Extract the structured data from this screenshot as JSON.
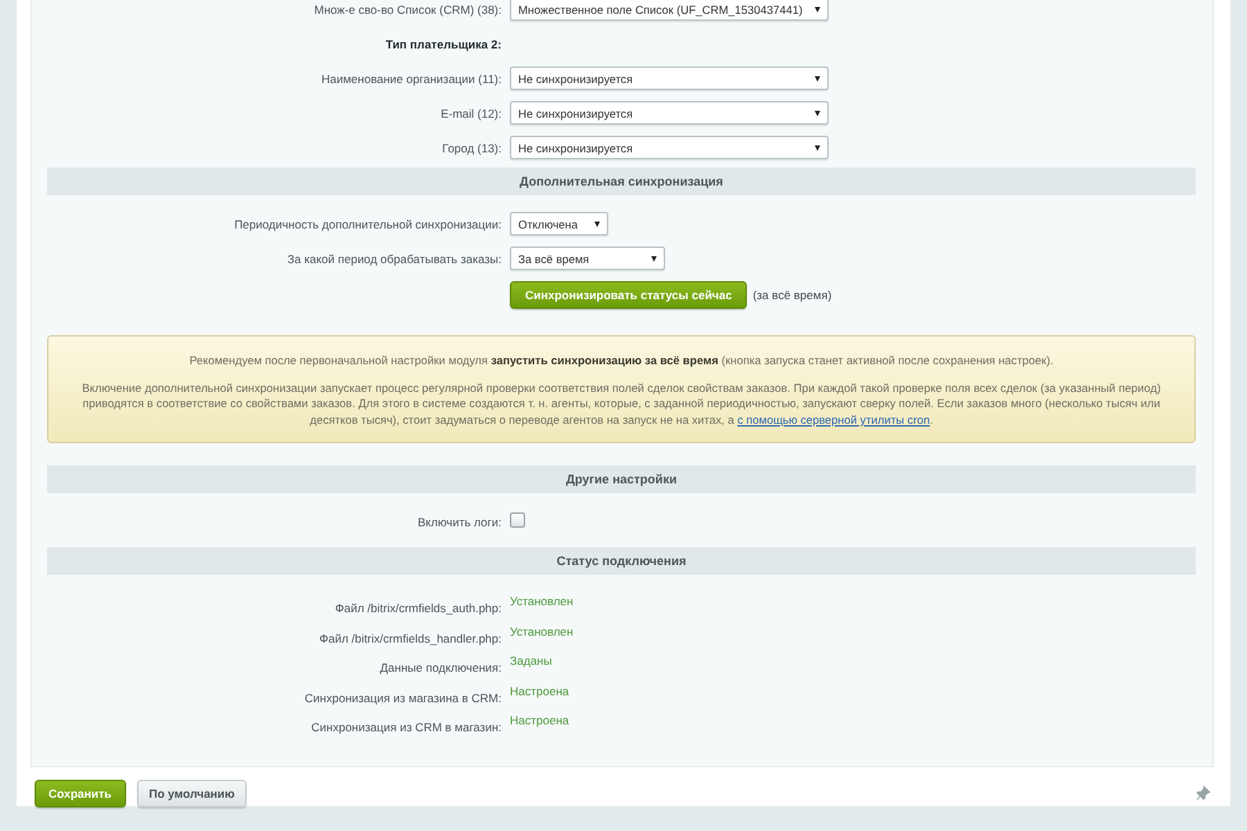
{
  "top_rows": [
    {
      "kind": "select",
      "label": "Множ-е сво-во Список (CRM) (38):",
      "value": "Множественное поле Список (UF_CRM_1530437441)"
    },
    {
      "kind": "subheading",
      "label": "Тип плательщика 2:"
    },
    {
      "kind": "select",
      "label": "Наименование организации (11):",
      "value": "Не синхронизируется"
    },
    {
      "kind": "select",
      "label": "E-mail (12):",
      "value": "Не синхронизируется"
    },
    {
      "kind": "select",
      "label": "Город (13):",
      "value": "Не синхронизируется"
    }
  ],
  "sections": [
    {
      "title": "Дополнительная синхронизация",
      "rows": [
        {
          "kind": "narrow-select",
          "label": "Периодичность дополнительной синхронизации:",
          "value": "Отключена"
        },
        {
          "kind": "medium-select",
          "label": "За какой период обрабатывать заказы:",
          "value": "За всё время"
        },
        {
          "kind": "action",
          "button": "Синхронизировать статусы сейчас",
          "note": "(за всё время)"
        }
      ],
      "notice": {
        "lead": "Рекомендуем после первоначальной настройки модуля **запустить синхронизацию за всё время** (кнопка запуска станет активной после сохранения настроек).",
        "body": "Включение дополнительной синхронизации запускает процесс регулярной проверки соответствия полей сделок свойствам заказов. При каждой такой проверке поля всех сделок (за указанный период) приводятся в соответствие со свойствами заказов. Для этого в системе создаются т. н. агенты, которые, с заданной периодичностью, запускают сверку полей. Если заказов много (несколько тысяч или десятков тысяч), стоит задуматься о переводе агентов на запуск не на хитах, а ",
        "link": "с помощью серверной утилиты cron",
        "body_end": "."
      }
    },
    {
      "title": "Другие настройки",
      "rows": [
        {
          "kind": "checkbox",
          "label": "Включить логи:",
          "checked": false
        }
      ]
    },
    {
      "title": "Статус подключения",
      "rows": [
        {
          "kind": "status",
          "label": "Файл /bitrix/crmfields_auth.php:",
          "value": "Установлен"
        },
        {
          "kind": "status",
          "label": "Файл /bitrix/crmfields_handler.php:",
          "value": "Установлен"
        },
        {
          "kind": "status",
          "label": "Данные подключения:",
          "value": "Заданы"
        },
        {
          "kind": "status",
          "label": "Синхронизация из магазина в CRM:",
          "value": "Настроена"
        },
        {
          "kind": "status",
          "label": "Синхронизация из CRM в магазин:",
          "value": "Настроена"
        }
      ]
    }
  ],
  "footer_buttons": [
    {
      "kind": "primary",
      "label": "Сохранить"
    },
    {
      "kind": "default",
      "label": "По умолчанию"
    }
  ]
}
